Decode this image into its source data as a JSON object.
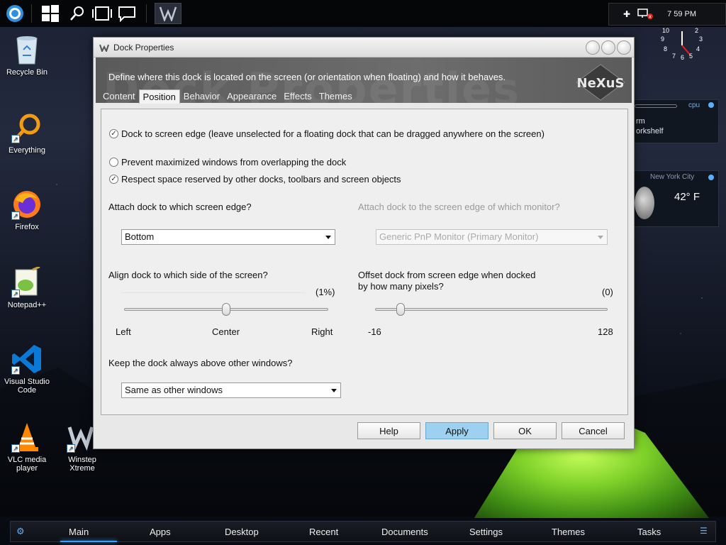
{
  "topbar": {
    "time": "7 59 PM"
  },
  "desktop_icons": [
    {
      "label": "Recycle Bin"
    },
    {
      "label": "Everything"
    },
    {
      "label": "Firefox"
    },
    {
      "label": "Notepad++"
    },
    {
      "label": "Visual Studio Code"
    },
    {
      "label": "VLC media player"
    },
    {
      "label": "Winstep Xtreme"
    }
  ],
  "clock_numbers": [
    "10",
    "9",
    "8",
    "7",
    "6",
    "5",
    "4",
    "3",
    "2"
  ],
  "widgets": {
    "cpu_label": "cpu",
    "task_line1": "rm",
    "task_line2": "orkshelf",
    "weather_city": "New York City",
    "weather_temp": "42° F"
  },
  "dialog": {
    "title": "Dock Properties",
    "watermark": "Dock Properties",
    "description": "Define where this dock is located on the screen (or orientation when floating) and how it behaves.",
    "logo_text": "NeXuS",
    "tabs": [
      "Content",
      "Position",
      "Behavior",
      "Appearance",
      "Effects",
      "Themes"
    ],
    "active_tab": "Position",
    "options": {
      "dock_to_edge": {
        "label": "Dock to screen edge (leave unselected for a floating dock that can be dragged anywhere on the screen)",
        "checked": true
      },
      "prevent_max": {
        "label": "Prevent maximized windows from overlapping the dock",
        "checked": false
      },
      "respect_space": {
        "label": "Respect space reserved by other docks, toolbars and screen objects",
        "checked": true
      }
    },
    "attach_edge_label": "Attach dock to which screen edge?",
    "attach_edge_value": "Bottom",
    "attach_monitor_label": "Attach dock to the screen edge of which monitor?",
    "attach_monitor_value": "Generic PnP Monitor (Primary Monitor)",
    "align_label": "Align dock to which side of the screen?",
    "align_value": "(1%)",
    "align_slider_fraction": 0.5,
    "align_min": "Left",
    "align_mid": "Center",
    "align_max": "Right",
    "offset_label_line1": "Offset dock from screen edge when docked",
    "offset_label_line2": "by how many pixels?",
    "offset_value": "(0)",
    "offset_slider_value": 0,
    "offset_min": "-16",
    "offset_max": "128",
    "above_label": "Keep the dock always above other windows?",
    "above_value": "Same as other windows",
    "buttons": {
      "help": "Help",
      "apply": "Apply",
      "ok": "OK",
      "cancel": "Cancel"
    }
  },
  "dock": {
    "items": [
      "Main",
      "Apps",
      "Desktop",
      "Recent",
      "Documents",
      "Settings",
      "Themes",
      "Tasks"
    ],
    "active": "Main"
  }
}
